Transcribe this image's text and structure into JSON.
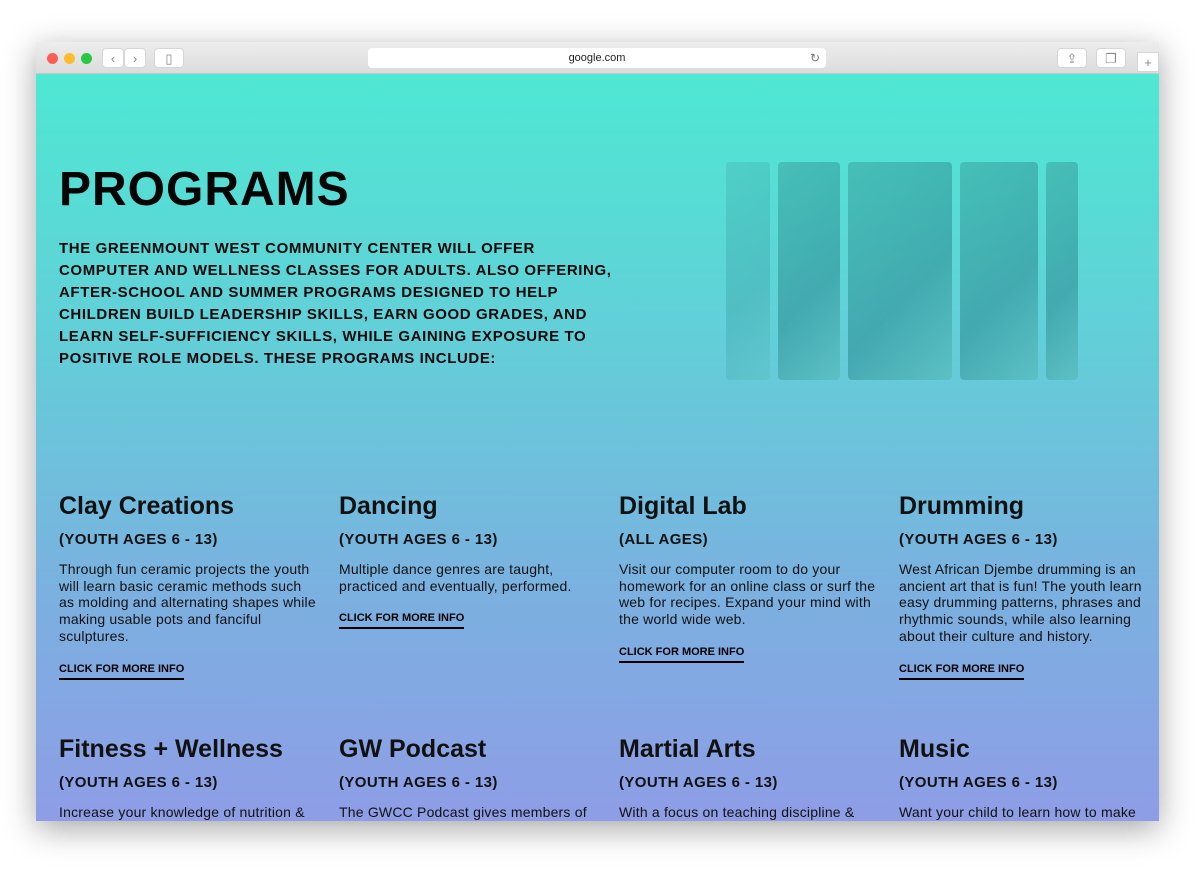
{
  "browser": {
    "url": "google.com",
    "colors": {
      "close": "#fd5f57",
      "minimize": "#febc2e",
      "maximize": "#28c840"
    }
  },
  "hero": {
    "title": "PROGRAMS",
    "intro": "The Greenmount West Community Center will offer computer and wellness classes for adults. Also offering, after-school and summer programs designed to help children build leadership skills, earn good grades, and learn self-sufficiency skills, while gaining exposure to positive role models. These programs include:"
  },
  "programs": [
    {
      "title": "Clay Creations",
      "ages": "(YOUTH AGES 6 - 13)",
      "desc": "Through fun ceramic projects the youth will learn basic ceramic methods such as molding and alternating shapes while making usable pots and fanciful sculptures.",
      "link": "CLICK FOR MORE INFO"
    },
    {
      "title": "Dancing",
      "ages": "(YOUTH AGES 6 - 13)",
      "desc": "Multiple dance genres are taught, practiced and eventually, performed.",
      "link": "CLICK FOR MORE INFO"
    },
    {
      "title": "Digital Lab",
      "ages": "(ALL AGES)",
      "desc": "Visit our computer room to do your homework for an online class or surf the web for recipes. Expand your mind with the world wide web.",
      "link": "CLICK FOR MORE INFO"
    },
    {
      "title": "Drumming",
      "ages": "(YOUTH AGES 6 - 13)",
      "desc": "West African Djembe drumming is an ancient art that is fun! The youth learn easy drumming patterns, phrases and rhythmic sounds, while also learning about their culture and history.",
      "link": "CLICK FOR MORE INFO"
    },
    {
      "title": "Fitness + Wellness",
      "ages": "(YOUTH AGES 6 - 13)",
      "desc": "Increase your knowledge of nutrition &"
    },
    {
      "title": "GW Podcast",
      "ages": "(YOUTH AGES 6 - 13)",
      "desc": "The GWCC Podcast gives members of"
    },
    {
      "title": "Martial Arts",
      "ages": "(YOUTH AGES 6 - 13)",
      "desc": "With a focus on teaching discipline &"
    },
    {
      "title": "Music",
      "ages": "(YOUTH AGES 6 - 13)",
      "desc": "Want your child to learn how to make"
    }
  ]
}
